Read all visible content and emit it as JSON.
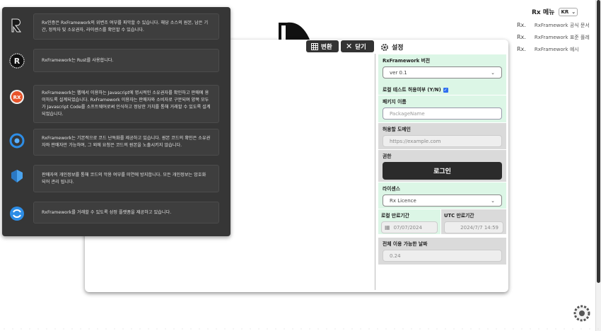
{
  "menu": {
    "title": "Rx 메뉴",
    "lang": "KR",
    "links": [
      {
        "key": "Rx.",
        "label": "RxFramework 공식 문서"
      },
      {
        "key": "Rx.",
        "label": "RxFramework 표준 플레"
      },
      {
        "key": "Rx.",
        "label": "RxFramework 예시"
      }
    ]
  },
  "toolbar": {
    "convert_label": "변환",
    "close_label": "닫기"
  },
  "settings": {
    "title": "설정",
    "version_label": "RxFramework 버전",
    "version_value": "ver 0.1",
    "local_test_label": "로컬 테스트 허용여부 (Y/N)",
    "package_label": "패키지 이름",
    "package_placeholder": "PackageName",
    "domain_label": "허용할 도메인",
    "domain_placeholder": "https://example.com",
    "auth_label": "권한",
    "login_label": "로그인",
    "license_label": "라이센스",
    "license_value": "Rx Licence",
    "local_expiry_label": "로컬 만료기간",
    "local_expiry_value": "07/07/2024",
    "utc_expiry_label": "UTC 만료기간",
    "utc_expiry_value": "2024/7/7 14:59",
    "total_days_label": "전체 이용 가능한 날짜",
    "total_days_value": "0.24"
  },
  "overlay": {
    "items": [
      {
        "icon": "rx-logo-icon",
        "text": "Rx인증은 RxFramework의 위변조 여부를 파악할 수 있습니다. 해당 소스의 원본, 남은 기간, 정작자 및 소유권자, 라이센스를 확인할 수 있습니다."
      },
      {
        "icon": "rust-icon",
        "text": "RxFramework는 Rust를 사용합니다."
      },
      {
        "icon": "rx-badge-icon",
        "text": "RxFramework는 웹에서 이용하는 Javascript에 명시적인 소유권자를 확인하고 판매에 용이하도록 설계되었습니다. RxFramework 이용자는 판매자와 소비자로 구분되며 양쪽 모두가 Javascript Code를 소프트웨어로써 인식하고 정당한 가치를 통해 거래할 수 있도록 설계되었습니다."
      },
      {
        "icon": "obfuscate-icon",
        "text": "RxFramework는 기본적으로 코드 난독화를 제공하고 있습니다. 원본 코드의 확인은 소유권자와 판매자만 가능하며, 그 외에 요청은 코드의 원본을 노출시키지 않습니다."
      },
      {
        "icon": "shield-icon",
        "text": "판매자의 개인정보를 통해 코드의 악용 여부를 미연에 방지합니다. 모든 개인정보는 암호화 되어 관리 됩니다."
      },
      {
        "icon": "platform-icon",
        "text": "RxFramework를 거래할 수 있도록 성정 플랫폼을 제공하고 있습니다."
      }
    ]
  },
  "colors": {
    "accent_green": "#dcf6e6",
    "overlay_bg": "#363636",
    "checkbox": "#2f6ff0"
  }
}
